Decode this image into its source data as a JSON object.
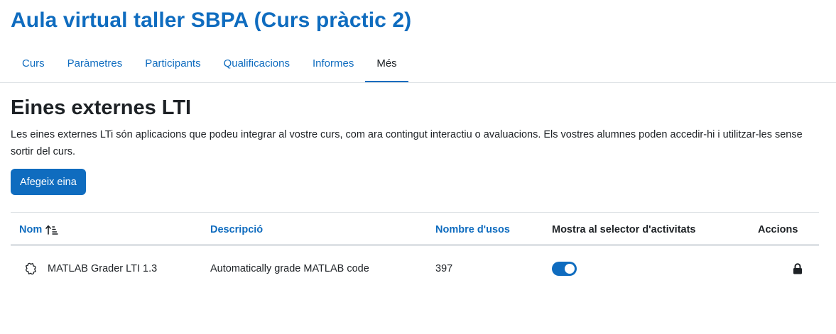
{
  "course": {
    "title": "Aula virtual taller SBPA (Curs pràctic 2)"
  },
  "nav": {
    "tabs": [
      {
        "label": "Curs",
        "active": false
      },
      {
        "label": "Paràmetres",
        "active": false
      },
      {
        "label": "Participants",
        "active": false
      },
      {
        "label": "Qualificacions",
        "active": false
      },
      {
        "label": "Informes",
        "active": false
      },
      {
        "label": "Més",
        "active": true
      }
    ]
  },
  "page": {
    "heading": "Eines externes LTI",
    "description": "Les eines externes LTi són aplicacions que podeu integrar al vostre curs, com ara contingut interactiu o avaluacions. Els vostres alumnes poden accedir-hi i utilitzar-les sense sortir del curs.",
    "add_button": "Afegeix eina"
  },
  "table": {
    "columns": {
      "name": "Nom",
      "description": "Descripció",
      "usage": "Nombre d'usos",
      "show_in_selector": "Mostra al selector d'activitats",
      "actions": "Accions"
    },
    "sort_icon": "sort-ascending-icon",
    "rows": [
      {
        "icon": "puzzle-icon",
        "name": "MATLAB Grader LTI 1.3",
        "description": "Automatically grade MATLAB code",
        "usage": "397",
        "show_in_selector": true,
        "action_icon": "lock-icon"
      }
    ]
  },
  "colors": {
    "accent": "#0f6cbf",
    "text": "#1d2125",
    "border": "#dee2e6"
  }
}
